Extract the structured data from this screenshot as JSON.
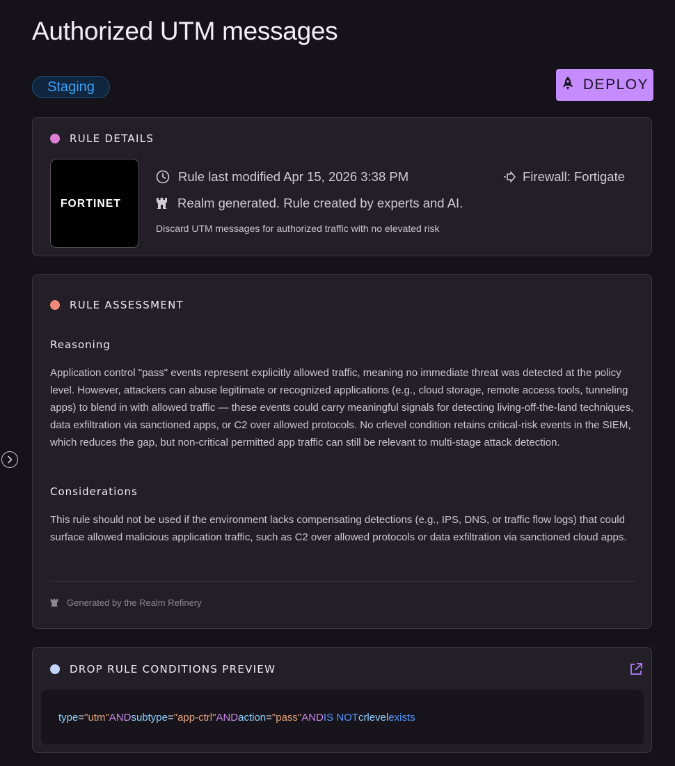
{
  "page": {
    "title": "Authorized UTM messages"
  },
  "status_badge": "Staging",
  "deploy_button": {
    "label": "DEPLOY",
    "icon": "rocket-icon"
  },
  "rule_details": {
    "title": "RULE DETAILS",
    "dot_color": "#e07fd8",
    "logo_text": "FORTINET",
    "last_modified": "Rule last modified Apr 15, 2026 3:38 PM",
    "firewall": "Firewall: Fortigate",
    "generated": "Realm generated. Rule created by experts and AI.",
    "description": "Discard UTM messages for authorized traffic with no elevated risk"
  },
  "rule_assessment": {
    "title": "RULE ASSESSMENT",
    "dot_color": "#f1897a",
    "reasoning_heading": "Reasoning",
    "reasoning_text": "Application control \"pass\" events represent explicitly allowed traffic, meaning no immediate threat was detected at the policy level. However, attackers can abuse legitimate or recognized applications (e.g., cloud storage, remote access tools, tunneling apps) to blend in with allowed traffic — these events could carry meaningful signals for detecting living-off-the-land techniques, data exfiltration via sanctioned apps, or C2 over allowed protocols. No crlevel condition retains critical-risk events in the SIEM, which reduces the gap, but non-critical permitted app traffic can still be relevant to multi-stage attack detection.",
    "considerations_heading": "Considerations",
    "considerations_text": "This rule should not be used if the environment lacks compensating detections (e.g., IPS, DNS, or traffic flow logs) that could surface allowed malicious application traffic, such as C2 over allowed protocols or data exfiltration via sanctioned cloud apps.",
    "footer": "Generated by the Realm Refinery"
  },
  "drop_rule": {
    "title": "DROP RULE CONDITIONS PREVIEW",
    "dot_color": "#c3d3ff",
    "tokens": {
      "f1": "type",
      "eq": "=",
      "v1": "\"utm\"",
      "and": "AND",
      "f2": "subtype",
      "v2": "\"app-ctrl\"",
      "f3": "action",
      "v3": "\"pass\"",
      "isnot": "IS NOT",
      "f4": "crlevel",
      "exists": "exists"
    }
  }
}
